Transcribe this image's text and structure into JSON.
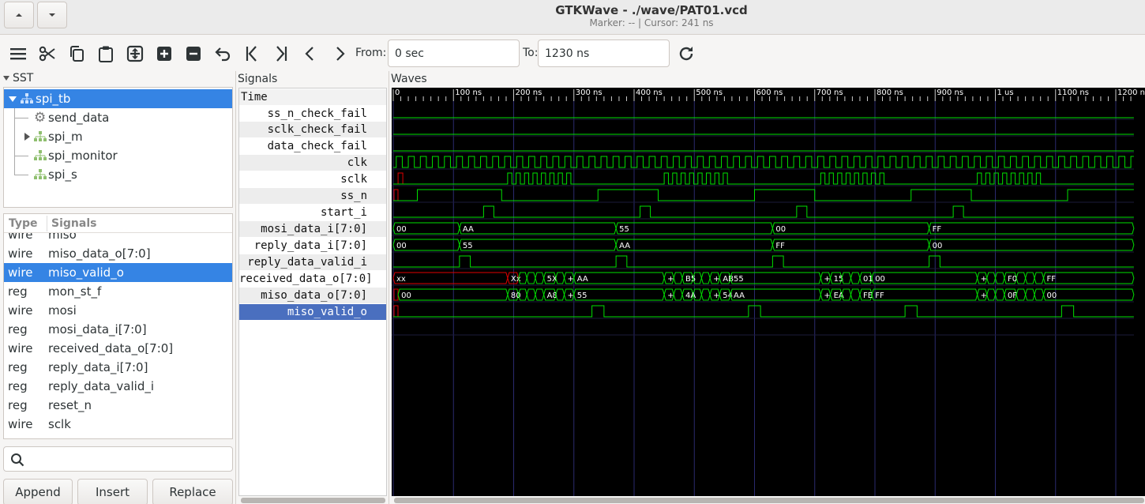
{
  "window": {
    "title": "GTKWave - ./wave/PAT01.vcd",
    "subtitle": "Marker: --  |  Cursor: 241 ns"
  },
  "toolbar": {
    "icons": [
      "menu-icon",
      "cut-icon",
      "copy-icon",
      "paste-icon",
      "zoom-fit-icon",
      "zoom-in-icon",
      "zoom-out-icon",
      "undo-icon",
      "jump-start-icon",
      "jump-end-icon",
      "previous-icon",
      "next-icon"
    ],
    "from_label": "From:",
    "from_value": "0 sec",
    "to_label": "To:",
    "to_value": "1230 ns",
    "reload_icon": "reload-icon"
  },
  "sst": {
    "header": "SST",
    "tree": [
      {
        "label": "spi_tb",
        "selected": true
      },
      {
        "label": "send_data"
      },
      {
        "label": "spi_m"
      },
      {
        "label": "spi_monitor"
      },
      {
        "label": "spi_s"
      }
    ]
  },
  "signal_list": {
    "col_type": "Type",
    "col_signals": "Signals",
    "rows": [
      {
        "type": "wire",
        "name": "miso"
      },
      {
        "type": "wire",
        "name": "miso_data_o[7:0]"
      },
      {
        "type": "wire",
        "name": "miso_valid_o",
        "selected": true
      },
      {
        "type": "reg",
        "name": "mon_st_f"
      },
      {
        "type": "wire",
        "name": "mosi"
      },
      {
        "type": "reg",
        "name": "mosi_data_i[7:0]"
      },
      {
        "type": "wire",
        "name": "received_data_o[7:0]"
      },
      {
        "type": "reg",
        "name": "reply_data_i[7:0]"
      },
      {
        "type": "reg",
        "name": "reply_data_valid_i"
      },
      {
        "type": "reg",
        "name": "reset_n"
      },
      {
        "type": "wire",
        "name": "sclk"
      }
    ]
  },
  "buttons": {
    "append": "Append",
    "insert": "Insert",
    "replace": "Replace"
  },
  "signals_pane": {
    "header": "Signals",
    "time_label": "Time",
    "names": [
      "ss_n_check_fail",
      "sclk_check_fail",
      "data_check_fail",
      "clk",
      "sclk",
      "ss_n",
      "start_i",
      "mosi_data_i[7:0]",
      "reply_data_i[7:0]",
      "reply_data_valid_i",
      "received_data_o[7:0]",
      "miso_data_o[7:0]",
      "miso_valid_o"
    ]
  },
  "waves_pane": {
    "header": "Waves",
    "ruler_ticks": [
      "0",
      "100 ns",
      "200 ns",
      "300 ns",
      "400 ns",
      "500 ns",
      "600 ns",
      "700 ns",
      "800 ns",
      "900 ns",
      "1 us",
      "1100 ns",
      "1200 ns"
    ],
    "range_ns": [
      0,
      1230
    ],
    "bus_values": {
      "mosi_data_i": [
        "00",
        "AA",
        "55",
        "00",
        "FF"
      ],
      "reply_data_i": [
        "00",
        "55",
        "AA",
        "FF",
        "00"
      ],
      "received_data_o": [
        "xx",
        "Xx",
        "5X",
        "AA",
        "B5",
        "AB",
        "55",
        "15",
        "01",
        "00",
        "F0",
        "FF"
      ],
      "miso_data_o": [
        "00",
        "80",
        "A8",
        "55",
        "4A",
        "54",
        "AA",
        "EA",
        "FE",
        "FF",
        "0F",
        "00"
      ]
    },
    "colors": {
      "wave": "#00e000",
      "undefined": "#e00000",
      "grid": "#2a2a6e",
      "bg": "#000000"
    }
  }
}
